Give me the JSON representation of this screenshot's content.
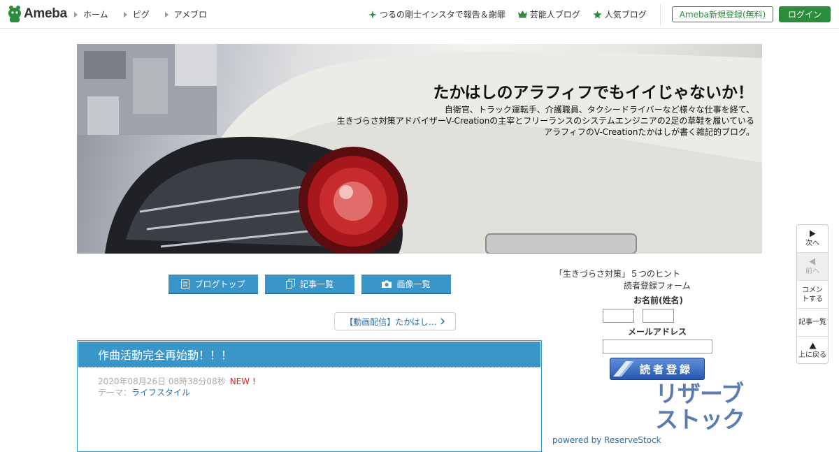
{
  "header": {
    "logo_text": "Ameba",
    "nav_left": [
      {
        "label": "ホーム"
      },
      {
        "label": "ピグ"
      },
      {
        "label": "アメブロ"
      }
    ],
    "nav_right": [
      {
        "label": "つるの剛士インスタで報告＆謝罪",
        "icon": "sparkle-icon"
      },
      {
        "label": "芸能人ブログ",
        "icon": "crown-icon"
      },
      {
        "label": "人気ブログ",
        "icon": "star-icon"
      }
    ],
    "register_label": "Ameba新規登録(無料)",
    "login_label": "ログイン",
    "accent_color": "#2d8c3c"
  },
  "banner": {
    "title": "たかはしのアラフィフでもイイじゃないか！",
    "desc_lines": [
      "自衛官、トラック運転手、介護職員、タクシードライバーなど様々な仕事を経て、",
      "生きづらさ対策アドバイザーV-Creationの主宰とフリーランスのシステムエンジニアの2足の草鞋を履いている",
      "アラフィフのV-Creationたかはしが書く雑記的ブログ。"
    ]
  },
  "blog_menu": [
    {
      "label": "ブログトップ",
      "icon": "document-icon"
    },
    {
      "label": "記事一覧",
      "icon": "copy-icon"
    },
    {
      "label": "画像一覧",
      "icon": "camera-icon"
    }
  ],
  "video_link": {
    "label": "【動画配信】たかはし…"
  },
  "article": {
    "title": "作曲活動完全再始動！！！",
    "date": "2020年08月26日 08時38分08秒",
    "new_label": "NEW !",
    "theme_prefix": "テーマ：",
    "theme": "ライフスタイル"
  },
  "sidebar": {
    "title": "「生きづらさ対策」５つのヒント",
    "form_title": "読者登録フォーム",
    "name_label": "お名前(姓名)",
    "email_label": "メールアドレス",
    "reader_button": "読者登録",
    "reserve_logo_line1": "リザーブ",
    "reserve_logo_line2": "ストック",
    "powered_by": "powered by ReserveStock"
  },
  "float_nav": [
    {
      "label": "次へ",
      "icon": "play-right-icon",
      "disabled": false
    },
    {
      "label": "前へ",
      "icon": "play-left-icon",
      "disabled": true
    },
    {
      "label": "コメントする",
      "icon": "",
      "disabled": false
    },
    {
      "label": "記事一覧",
      "icon": "",
      "disabled": false
    },
    {
      "label": "上に戻る",
      "icon": "up-arrow-icon",
      "disabled": false
    }
  ],
  "colors": {
    "blog_blue": "#3a95c9",
    "link_blue": "#2a6ea6",
    "new_red": "#e3201b"
  }
}
